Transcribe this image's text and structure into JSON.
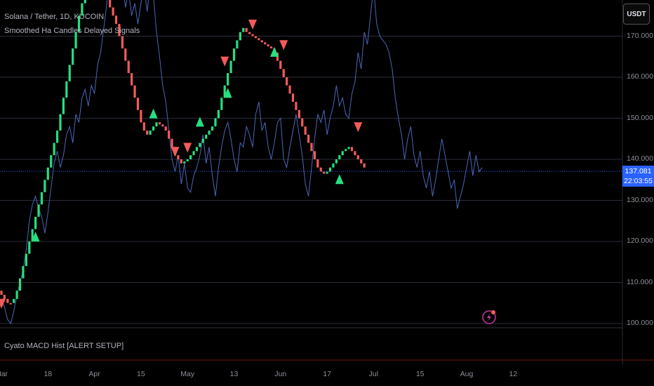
{
  "header": {
    "symbol_line": "Solana / Tether, 1D, KUCOIN",
    "indicator_line": "Smoothed Ha Candles Delayed Signals",
    "sub_indicator": "Cyato MACD Hist [ALERT SETUP]"
  },
  "price_scale": {
    "currency_button": "USDT",
    "last_price": "137.081",
    "countdown": "22:03:55"
  },
  "colors": {
    "background": "#000000",
    "bull": "#26e07f",
    "bear": "#f55b5b",
    "line": "#4a67b9",
    "gridline": "#2a2e39",
    "axis_text": "#8b8f98",
    "price_tag": "#2962ff",
    "lightning_badge": "#c93aa0"
  },
  "chart_data": {
    "type": "line",
    "title": "Solana / Tether, 1D, KUCOIN",
    "ylim": [
      99,
      176
    ],
    "y_ticks": [
      "100.000",
      "110.000",
      "120.000",
      "130.000",
      "140.000",
      "150.000",
      "160.000",
      "170.000"
    ],
    "y_tick_values": [
      100,
      110,
      120,
      130,
      140,
      150,
      160,
      170
    ],
    "x_ticks": [
      "Mar",
      "18",
      "Apr",
      "15",
      "May",
      "13",
      "Jun",
      "17",
      "Jul",
      "15",
      "Aug",
      "12"
    ],
    "x_tick_index": [
      0,
      15,
      30,
      45,
      60,
      75,
      90,
      105,
      120,
      135,
      150,
      165
    ],
    "last_price_value": 137.081,
    "close_line": [
      106,
      104,
      101,
      100,
      103,
      107,
      110,
      113,
      118,
      125,
      129,
      131,
      128,
      126,
      122,
      127,
      133,
      139,
      142,
      138,
      141,
      146,
      148,
      144,
      151,
      149,
      155,
      157,
      153,
      158,
      156,
      163,
      166,
      172,
      178,
      186,
      192,
      188,
      181,
      183,
      177,
      181,
      175,
      178,
      173,
      178,
      182,
      176,
      183,
      180,
      171,
      165,
      158,
      154,
      147,
      140,
      137,
      141,
      134,
      139,
      133,
      132,
      136,
      138,
      141,
      146,
      139,
      143,
      136,
      131,
      138,
      143,
      147,
      149,
      145,
      140,
      137,
      144,
      143,
      148,
      146,
      143,
      151,
      154,
      147,
      149,
      143,
      140,
      144,
      149,
      150,
      140,
      138,
      143,
      147,
      151,
      146,
      141,
      134,
      131,
      138,
      145,
      151,
      149,
      152,
      146,
      150,
      153,
      158,
      153,
      155,
      151,
      150,
      156,
      159,
      166,
      162,
      171,
      168,
      175,
      182,
      173,
      170,
      169,
      168,
      166,
      162,
      155,
      150,
      146,
      140,
      145,
      148,
      141,
      138,
      142,
      136,
      133,
      137,
      131,
      135,
      140,
      145,
      141,
      137,
      133,
      135,
      128,
      131,
      134,
      138,
      142,
      136,
      141,
      137,
      138
    ],
    "ha_candles": [
      {
        "o": 108,
        "c": 107,
        "s": "bear"
      },
      {
        "o": 107,
        "c": 106,
        "s": "bear"
      },
      {
        "o": 106,
        "c": 105,
        "s": "bear"
      },
      {
        "o": 105,
        "c": 105,
        "s": "bear"
      },
      {
        "o": 105,
        "c": 106,
        "s": "bull"
      },
      {
        "o": 106,
        "c": 108,
        "s": "bull"
      },
      {
        "o": 108,
        "c": 111,
        "s": "bull"
      },
      {
        "o": 111,
        "c": 114,
        "s": "bull"
      },
      {
        "o": 114,
        "c": 117,
        "s": "bull"
      },
      {
        "o": 117,
        "c": 120,
        "s": "bull"
      },
      {
        "o": 120,
        "c": 123,
        "s": "bull"
      },
      {
        "o": 123,
        "c": 126,
        "s": "bull"
      },
      {
        "o": 126,
        "c": 129,
        "s": "bull"
      },
      {
        "o": 129,
        "c": 132,
        "s": "bull"
      },
      {
        "o": 132,
        "c": 135,
        "s": "bull"
      },
      {
        "o": 135,
        "c": 138,
        "s": "bull"
      },
      {
        "o": 138,
        "c": 141,
        "s": "bull"
      },
      {
        "o": 141,
        "c": 144,
        "s": "bull"
      },
      {
        "o": 144,
        "c": 147,
        "s": "bull"
      },
      {
        "o": 147,
        "c": 151,
        "s": "bull"
      },
      {
        "o": 151,
        "c": 155,
        "s": "bull"
      },
      {
        "o": 155,
        "c": 159,
        "s": "bull"
      },
      {
        "o": 159,
        "c": 163,
        "s": "bull"
      },
      {
        "o": 163,
        "c": 167,
        "s": "bull"
      },
      {
        "o": 167,
        "c": 171,
        "s": "bull"
      },
      {
        "o": 171,
        "c": 175,
        "s": "bull"
      },
      {
        "o": 175,
        "c": 178,
        "s": "bull"
      },
      {
        "o": 178,
        "c": 181,
        "s": "bull"
      },
      {
        "o": 181,
        "c": 183,
        "s": "bull"
      },
      {
        "o": 183,
        "c": 185,
        "s": "bull"
      },
      {
        "o": 185,
        "c": 186,
        "s": "bull"
      },
      {
        "o": 186,
        "c": 185,
        "s": "bear"
      },
      {
        "o": 185,
        "c": 183,
        "s": "bear"
      },
      {
        "o": 183,
        "c": 181,
        "s": "bear"
      },
      {
        "o": 181,
        "c": 179,
        "s": "bear"
      },
      {
        "o": 179,
        "c": 177,
        "s": "bear"
      },
      {
        "o": 177,
        "c": 175,
        "s": "bear"
      },
      {
        "o": 175,
        "c": 173,
        "s": "bear"
      },
      {
        "o": 173,
        "c": 170,
        "s": "bear"
      },
      {
        "o": 170,
        "c": 167,
        "s": "bear"
      },
      {
        "o": 167,
        "c": 164,
        "s": "bear"
      },
      {
        "o": 164,
        "c": 161,
        "s": "bear"
      },
      {
        "o": 161,
        "c": 158,
        "s": "bear"
      },
      {
        "o": 158,
        "c": 155,
        "s": "bear"
      },
      {
        "o": 155,
        "c": 152,
        "s": "bear"
      },
      {
        "o": 152,
        "c": 149,
        "s": "bear"
      },
      {
        "o": 149,
        "c": 147,
        "s": "bear"
      },
      {
        "o": 147,
        "c": 146,
        "s": "bear"
      },
      {
        "o": 146,
        "c": 147,
        "s": "bull"
      },
      {
        "o": 147,
        "c": 148,
        "s": "bull"
      },
      {
        "o": 148,
        "c": 149,
        "s": "bull"
      },
      {
        "o": 149,
        "c": 148.5,
        "s": "bear"
      },
      {
        "o": 148.5,
        "c": 148,
        "s": "bear"
      },
      {
        "o": 148,
        "c": 147,
        "s": "bear"
      },
      {
        "o": 147,
        "c": 145,
        "s": "bear"
      },
      {
        "o": 145,
        "c": 143,
        "s": "bear"
      },
      {
        "o": 143,
        "c": 141,
        "s": "bear"
      },
      {
        "o": 141,
        "c": 140,
        "s": "bear"
      },
      {
        "o": 140,
        "c": 139,
        "s": "bear"
      },
      {
        "o": 139,
        "c": 139.5,
        "s": "bull"
      },
      {
        "o": 139.5,
        "c": 140,
        "s": "bull"
      },
      {
        "o": 140,
        "c": 141,
        "s": "bull"
      },
      {
        "o": 141,
        "c": 142,
        "s": "bull"
      },
      {
        "o": 142,
        "c": 143,
        "s": "bull"
      },
      {
        "o": 143,
        "c": 144,
        "s": "bull"
      },
      {
        "o": 144,
        "c": 145,
        "s": "bull"
      },
      {
        "o": 145,
        "c": 146,
        "s": "bull"
      },
      {
        "o": 146,
        "c": 147,
        "s": "bull"
      },
      {
        "o": 147,
        "c": 148,
        "s": "bull"
      },
      {
        "o": 148,
        "c": 150,
        "s": "bull"
      },
      {
        "o": 150,
        "c": 152,
        "s": "bull"
      },
      {
        "o": 152,
        "c": 155,
        "s": "bull"
      },
      {
        "o": 155,
        "c": 158,
        "s": "bull"
      },
      {
        "o": 158,
        "c": 161,
        "s": "bull"
      },
      {
        "o": 161,
        "c": 164,
        "s": "bull"
      },
      {
        "o": 164,
        "c": 167,
        "s": "bull"
      },
      {
        "o": 167,
        "c": 169,
        "s": "bull"
      },
      {
        "o": 169,
        "c": 171,
        "s": "bull"
      },
      {
        "o": 171,
        "c": 172,
        "s": "bull"
      },
      {
        "o": 172,
        "c": 171,
        "s": "bear"
      },
      {
        "o": 171,
        "c": 170.5,
        "s": "bear"
      },
      {
        "o": 170.5,
        "c": 170,
        "s": "bear"
      },
      {
        "o": 170,
        "c": 169.5,
        "s": "bear"
      },
      {
        "o": 169.5,
        "c": 169,
        "s": "bear"
      },
      {
        "o": 169,
        "c": 168.5,
        "s": "bear"
      },
      {
        "o": 168.5,
        "c": 168,
        "s": "bear"
      },
      {
        "o": 168,
        "c": 167.5,
        "s": "bear"
      },
      {
        "o": 167.5,
        "c": 167,
        "s": "bear"
      },
      {
        "o": 167,
        "c": 166,
        "s": "bear"
      },
      {
        "o": 166,
        "c": 164,
        "s": "bear"
      },
      {
        "o": 164,
        "c": 162,
        "s": "bear"
      },
      {
        "o": 162,
        "c": 160,
        "s": "bear"
      },
      {
        "o": 160,
        "c": 158,
        "s": "bear"
      },
      {
        "o": 158,
        "c": 156,
        "s": "bear"
      },
      {
        "o": 156,
        "c": 154,
        "s": "bear"
      },
      {
        "o": 154,
        "c": 152,
        "s": "bear"
      },
      {
        "o": 152,
        "c": 150,
        "s": "bear"
      },
      {
        "o": 150,
        "c": 148,
        "s": "bear"
      },
      {
        "o": 148,
        "c": 146,
        "s": "bear"
      },
      {
        "o": 146,
        "c": 144,
        "s": "bear"
      },
      {
        "o": 144,
        "c": 142,
        "s": "bear"
      },
      {
        "o": 142,
        "c": 140,
        "s": "bear"
      },
      {
        "o": 140,
        "c": 138,
        "s": "bear"
      },
      {
        "o": 138,
        "c": 137,
        "s": "bear"
      },
      {
        "o": 137,
        "c": 136.5,
        "s": "bear"
      },
      {
        "o": 136.5,
        "c": 137,
        "s": "bull"
      },
      {
        "o": 137,
        "c": 138,
        "s": "bull"
      },
      {
        "o": 138,
        "c": 139,
        "s": "bull"
      },
      {
        "o": 139,
        "c": 140,
        "s": "bull"
      },
      {
        "o": 140,
        "c": 141,
        "s": "bull"
      },
      {
        "o": 141,
        "c": 142,
        "s": "bull"
      },
      {
        "o": 142,
        "c": 142.5,
        "s": "bull"
      },
      {
        "o": 142.5,
        "c": 143,
        "s": "bull"
      },
      {
        "o": 143,
        "c": 142,
        "s": "bear"
      },
      {
        "o": 142,
        "c": 141,
        "s": "bear"
      },
      {
        "o": 141,
        "c": 140,
        "s": "bear"
      },
      {
        "o": 140,
        "c": 139,
        "s": "bear"
      },
      {
        "o": 139,
        "c": 138,
        "s": "bear"
      }
    ],
    "ha_start_index": 0,
    "ha_index_step": 1,
    "signals": [
      {
        "i": 0,
        "price": 105,
        "dir": "down"
      },
      {
        "i": 11,
        "price": 121,
        "dir": "up"
      },
      {
        "i": 49,
        "price": 151,
        "dir": "up"
      },
      {
        "i": 56,
        "price": 142,
        "dir": "down"
      },
      {
        "i": 60,
        "price": 143,
        "dir": "down"
      },
      {
        "i": 64,
        "price": 149,
        "dir": "up"
      },
      {
        "i": 72,
        "price": 164,
        "dir": "down"
      },
      {
        "i": 73,
        "price": 156,
        "dir": "up"
      },
      {
        "i": 81,
        "price": 173,
        "dir": "down"
      },
      {
        "i": 88,
        "price": 166,
        "dir": "up"
      },
      {
        "i": 91,
        "price": 168,
        "dir": "down"
      },
      {
        "i": 109,
        "price": 135,
        "dir": "up"
      },
      {
        "i": 115,
        "price": 148,
        "dir": "down"
      }
    ]
  }
}
